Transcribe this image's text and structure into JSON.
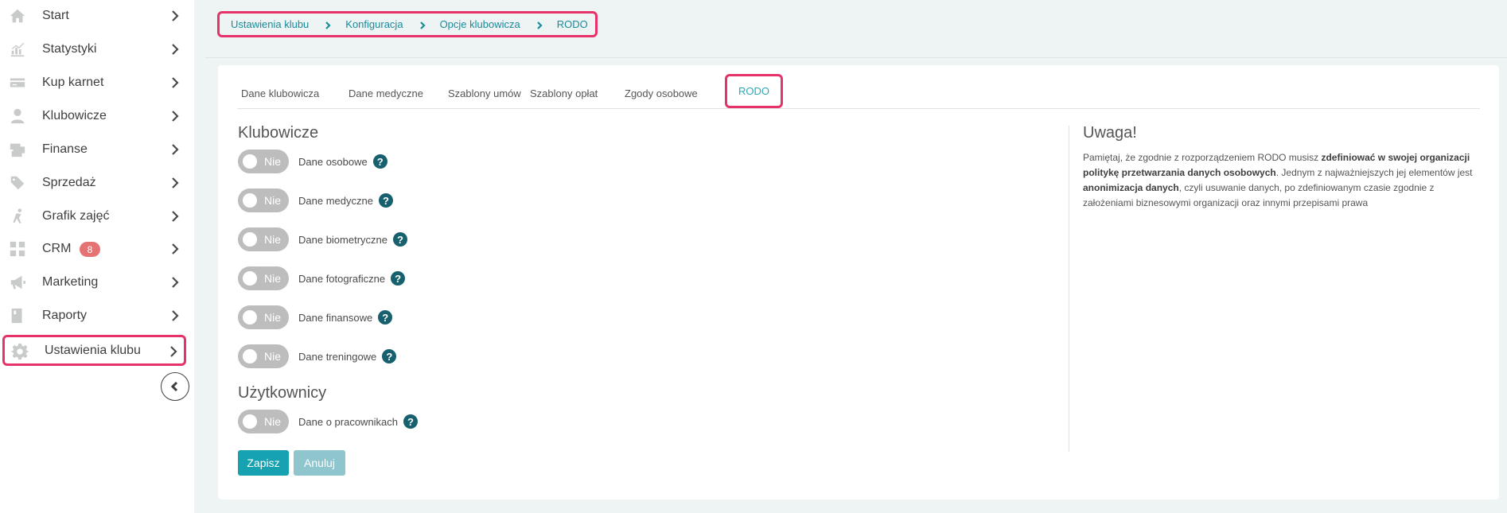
{
  "sidebar": {
    "items": [
      {
        "label": "Start",
        "icon": "home-icon"
      },
      {
        "label": "Statystyki",
        "icon": "chart-icon"
      },
      {
        "label": "Kup karnet",
        "icon": "card-icon"
      },
      {
        "label": "Klubowicze",
        "icon": "user-icon"
      },
      {
        "label": "Finanse",
        "icon": "finance-icon"
      },
      {
        "label": "Sprzedaż",
        "icon": "tag-icon"
      },
      {
        "label": "Grafik zajęć",
        "icon": "runner-icon"
      },
      {
        "label": "CRM",
        "icon": "grid-icon",
        "badge": "8"
      },
      {
        "label": "Marketing",
        "icon": "megaphone-icon"
      },
      {
        "label": "Raporty",
        "icon": "report-icon"
      },
      {
        "label": "Ustawienia klubu",
        "icon": "gear-icon",
        "active": true
      }
    ]
  },
  "breadcrumb": {
    "items": [
      "Ustawienia klubu",
      "Konfiguracja",
      "Opcje klubowicza",
      "RODO"
    ]
  },
  "tabs": {
    "items": [
      "Dane klubowicza",
      "Dane medyczne",
      "Szablony umów",
      "Szablony opłat",
      "Zgody osobowe",
      "RODO"
    ],
    "active": "RODO"
  },
  "sections": {
    "klubowicze": {
      "title": "Klubowicze",
      "rows": [
        {
          "toggle": "Nie",
          "label": "Dane osobowe"
        },
        {
          "toggle": "Nie",
          "label": "Dane medyczne"
        },
        {
          "toggle": "Nie",
          "label": "Dane biometryczne"
        },
        {
          "toggle": "Nie",
          "label": "Dane fotograficzne"
        },
        {
          "toggle": "Nie",
          "label": "Dane finansowe"
        },
        {
          "toggle": "Nie",
          "label": "Dane treningowe"
        }
      ]
    },
    "uzytkownicy": {
      "title": "Użytkownicy",
      "rows": [
        {
          "toggle": "Nie",
          "label": "Dane o pracownikach"
        }
      ]
    }
  },
  "help_glyph": "?",
  "buttons": {
    "save": "Zapisz",
    "cancel": "Anuluj"
  },
  "note": {
    "title": "Uwaga!",
    "parts": [
      {
        "t": "Pamiętaj, że zgodnie z rozporządzeniem RODO musisz ",
        "b": false
      },
      {
        "t": "zdefiniować w swojej organizacji politykę przetwarzania danych osobowych",
        "b": true
      },
      {
        "t": ". Jednym z najważniejszych jej elementów jest ",
        "b": false
      },
      {
        "t": "anonimizacja danych",
        "b": true
      },
      {
        "t": ", czyli usuwanie danych, po zdefiniowanym czasie zgodnie z założeniami biznesowymi organizacji oraz innymi przepisami prawa",
        "b": false
      }
    ]
  },
  "colors": {
    "accent": "#16a2b1",
    "highlight": "#e5336a",
    "help": "#17606d",
    "toggle_off": "#bdbdbd",
    "badge": "#e57373"
  }
}
